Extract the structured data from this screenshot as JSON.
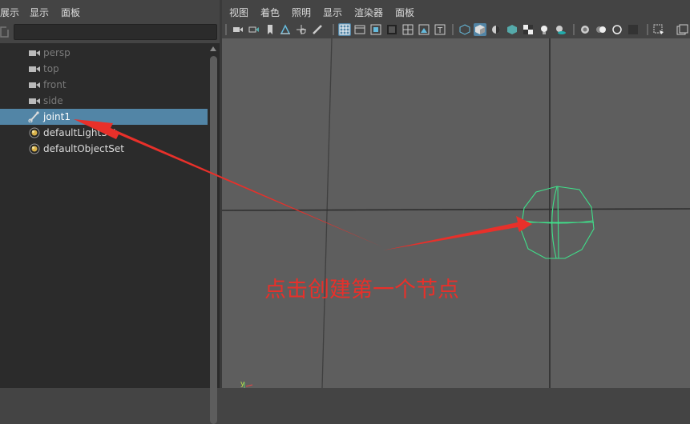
{
  "outliner": {
    "menu": [
      "展示",
      "显示",
      "面板"
    ],
    "items": [
      {
        "label": "persp",
        "icon": "camera-icon",
        "state": "dim"
      },
      {
        "label": "top",
        "icon": "camera-icon",
        "state": "dim"
      },
      {
        "label": "front",
        "icon": "camera-icon",
        "state": "dim"
      },
      {
        "label": "side",
        "icon": "camera-icon",
        "state": "dim"
      },
      {
        "label": "joint1",
        "icon": "joint-icon",
        "state": "selected"
      },
      {
        "label": "defaultLightSet",
        "icon": "set-icon",
        "state": "normal"
      },
      {
        "label": "defaultObjectSet",
        "icon": "set-icon",
        "state": "normal"
      }
    ]
  },
  "viewport": {
    "menu": [
      "视图",
      "着色",
      "照明",
      "显示",
      "渲染器",
      "面板"
    ],
    "axis_label": "y",
    "joint_color": "#3fe08a"
  },
  "annotation": {
    "text": "点击创建第一个节点",
    "color": "#e8302a"
  },
  "colors": {
    "selection": "#5285a6",
    "panel_bg": "#2b2b2b",
    "viewport_bg": "#5e5e5e"
  }
}
